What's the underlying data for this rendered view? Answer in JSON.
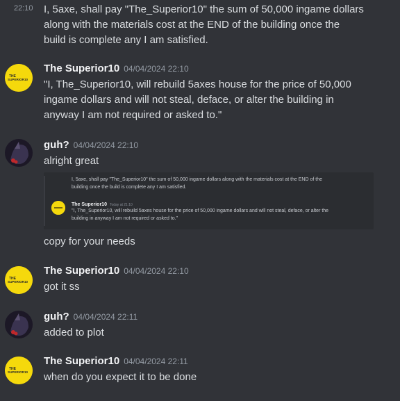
{
  "messages": {
    "first_continuation": {
      "time": "22:10",
      "lines": [
        "I, 5axe, shall pay \"The_Superior10\" the sum of 50,000 ingame dollars",
        "along with the materials cost at the END of the building once the",
        "build is complete any I am satisfied."
      ]
    },
    "g1": {
      "username": "The Superior10",
      "timestamp": "04/04/2024 22:10",
      "avatar_text": "THE SUPERIOR10",
      "lines": [
        "\"I, The_Superior10, will rebuild 5axes house for the price of 50,000",
        "ingame dollars and will not steal, deface, or alter the building in",
        "anyway I am not required or asked to.\""
      ]
    },
    "g2": {
      "username": "guh?",
      "timestamp": "04/04/2024 22:10",
      "line1": "alright great",
      "embed": {
        "line1": "I, 5axe, shall pay \"The_Superior10\" the sum of 50,000 ingame dollars along with the materials cost at the END of the",
        "line2": "building once the build is complete any I am satisfied.",
        "username": "The Superior10",
        "time": "Today at 21:10",
        "body1": "\"I, The_Superior10, will rebuild 5axes house for the price of 50,000 ingame dollars and will not steal, deface, or alter the",
        "body2": "building in anyway I am not required or asked to.\""
      },
      "line2": "copy for your needs"
    },
    "g3": {
      "username": "The Superior10",
      "timestamp": "04/04/2024 22:10",
      "line1": "got it ss"
    },
    "g4": {
      "username": "guh?",
      "timestamp": "04/04/2024 22:11",
      "line1": "added to plot"
    },
    "g5": {
      "username": "The Superior10",
      "timestamp": "04/04/2024 22:11",
      "line1": "when do you expect it to be done"
    }
  },
  "colors": {
    "background": "#313338",
    "username": "#f2f3f5",
    "timestamp": "#949ba4",
    "text": "#dbdee1",
    "superior_avatar": "#f5d90c"
  }
}
